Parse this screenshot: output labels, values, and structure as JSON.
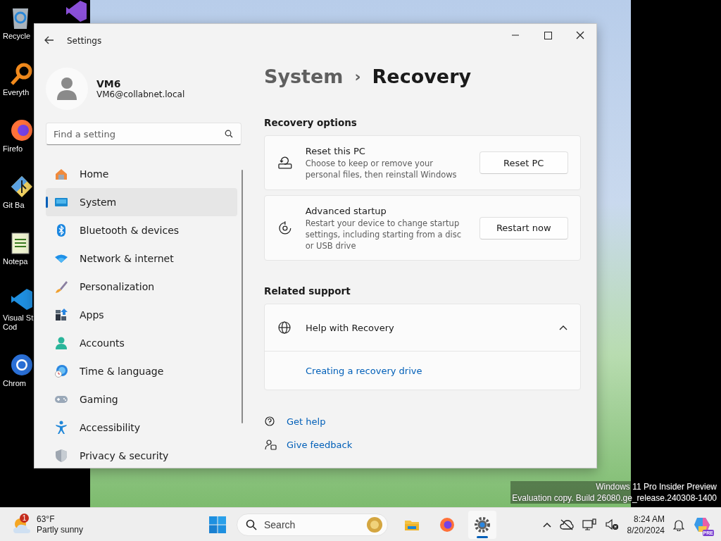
{
  "desktop": {
    "icons": [
      {
        "label": "Recycle"
      },
      {
        "label": "Everyth"
      },
      {
        "label": "Firefo"
      },
      {
        "label": "Git Ba"
      },
      {
        "label": "Notepa"
      },
      {
        "label": "Visual St\nCod"
      },
      {
        "label": "Chrom"
      }
    ],
    "watermark": [
      "Windows 11 Pro Insider Preview",
      "Evaluation copy. Build 26080.ge_release.240308-1400"
    ]
  },
  "window": {
    "title": "Settings",
    "user": {
      "name": "VM6",
      "email": "VM6@collabnet.local"
    },
    "search": {
      "placeholder": "Find a setting"
    },
    "nav": [
      {
        "label": "Home",
        "selected": false
      },
      {
        "label": "System",
        "selected": true
      },
      {
        "label": "Bluetooth & devices",
        "selected": false
      },
      {
        "label": "Network & internet",
        "selected": false
      },
      {
        "label": "Personalization",
        "selected": false
      },
      {
        "label": "Apps",
        "selected": false
      },
      {
        "label": "Accounts",
        "selected": false
      },
      {
        "label": "Time & language",
        "selected": false
      },
      {
        "label": "Gaming",
        "selected": false
      },
      {
        "label": "Accessibility",
        "selected": false
      },
      {
        "label": "Privacy & security",
        "selected": false
      }
    ],
    "breadcrumb": {
      "parent": "System",
      "separator": "›",
      "current": "Recovery"
    },
    "sections": [
      {
        "kind": "cards",
        "title": "Recovery options",
        "cards": [
          {
            "title": "Reset this PC",
            "description": "Choose to keep or remove your personal files, then reinstall Windows",
            "button": "Reset PC"
          },
          {
            "title": "Advanced startup",
            "description": "Restart your device to change startup settings, including starting from a disc or USB drive",
            "button": "Restart now"
          }
        ]
      },
      {
        "kind": "expander",
        "title": "Related support",
        "expander": {
          "title": "Help with Recovery",
          "expanded": true,
          "links": [
            "Creating a recovery drive"
          ]
        }
      }
    ],
    "help_links": [
      "Get help",
      "Give feedback"
    ]
  },
  "taskbar": {
    "weather": {
      "badge": "1",
      "temperature": "63°F",
      "condition": "Partly sunny"
    },
    "search": {
      "placeholder": "Search"
    },
    "apps": [
      {
        "selected": false
      },
      {
        "selected": false
      },
      {
        "selected": true
      }
    ],
    "clock": {
      "time": "8:24 AM",
      "date": "8/20/2024"
    },
    "copilot_badge": "PRE"
  }
}
